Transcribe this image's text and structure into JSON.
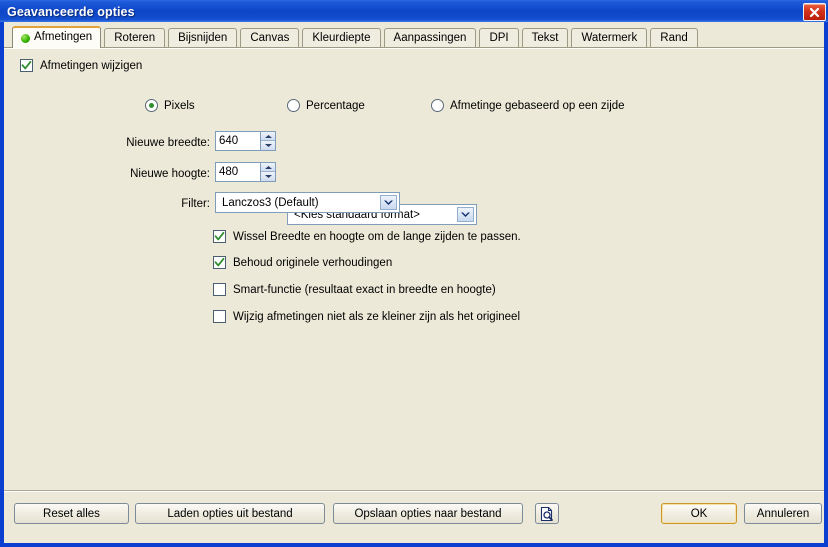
{
  "window": {
    "title": "Geavanceerde opties",
    "close_icon": "close-x-icon",
    "border_color": "#0a3fcf",
    "titlebar_color": "#0d45c8",
    "panel_color": "#ece9d8"
  },
  "tabs": [
    {
      "label": "Afmetingen",
      "active": true,
      "indicator": "green-dot-icon"
    },
    {
      "label": "Roteren",
      "active": false
    },
    {
      "label": "Bijsnijden",
      "active": false
    },
    {
      "label": "Canvas",
      "active": false
    },
    {
      "label": "Kleurdiepte",
      "active": false
    },
    {
      "label": "Aanpassingen",
      "active": false
    },
    {
      "label": "DPI",
      "active": false
    },
    {
      "label": "Tekst",
      "active": false
    },
    {
      "label": "Watermerk",
      "active": false
    },
    {
      "label": "Rand",
      "active": false
    }
  ],
  "main": {
    "enable_checkbox": {
      "label": "Afmetingen wijzigen",
      "checked": true
    },
    "mode_radios": [
      {
        "label": "Pixels",
        "selected": true
      },
      {
        "label": "Percentage",
        "selected": false
      },
      {
        "label": "Afmetinge gebaseerd op een zijde",
        "selected": false
      }
    ],
    "width_field": {
      "label": "Nieuwe breedte:",
      "value": "640"
    },
    "height_field": {
      "label": "Nieuwe hoogte:",
      "value": "480"
    },
    "preset_combo": {
      "value": "<Kies standaard format>",
      "arrow_icon": "chevron-down-icon"
    },
    "filter_combo": {
      "label": "Filter:",
      "value": "Lanczos3 (Default)",
      "arrow_icon": "chevron-down-icon"
    },
    "options": [
      {
        "label": "Wissel Breedte en hoogte om de lange zijden te passen.",
        "checked": true
      },
      {
        "label": "Behoud originele verhoudingen",
        "checked": true
      },
      {
        "label": "Smart-functie (resultaat exact in breedte en hoogte)",
        "checked": false
      },
      {
        "label": "Wijzig afmetingen niet als ze kleiner zijn als het origineel",
        "checked": false
      }
    ]
  },
  "footer": {
    "reset_label": "Reset alles",
    "load_label": "Laden opties uit bestand",
    "save_label": "Opslaan opties naar bestand",
    "preview_icon": "document-preview-icon",
    "ok_label": "OK",
    "cancel_label": "Annuleren",
    "default_button_accent": "#c9962a"
  }
}
